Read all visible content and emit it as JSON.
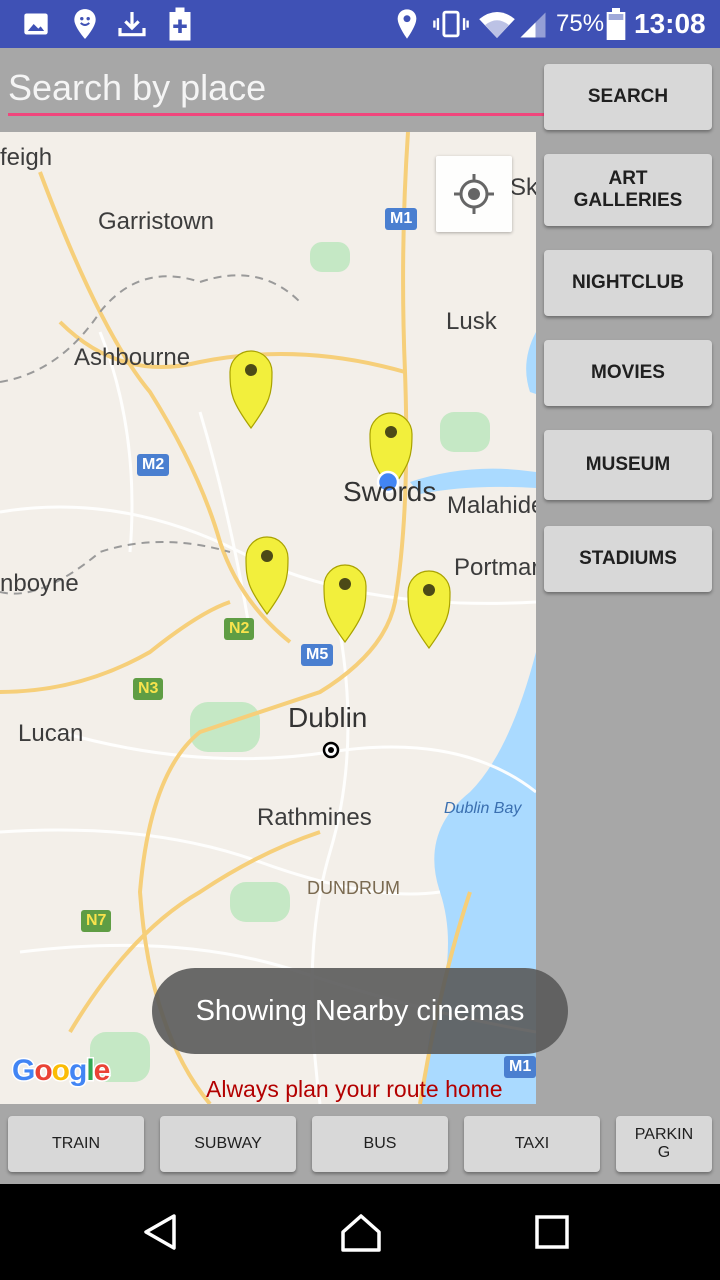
{
  "status_bar": {
    "battery_percent": "75%",
    "time": "13:08",
    "icons": [
      "image-icon",
      "location-pin-icon",
      "download-icon",
      "battery-plus-icon",
      "location-icon",
      "vibrate-icon",
      "wifi-icon",
      "signal-icon",
      "battery-icon"
    ]
  },
  "search": {
    "placeholder": "Search by place",
    "value": "",
    "button_label": "SEARCH"
  },
  "categories": {
    "art_galleries": "ART GALLERIES",
    "nightclub": "NIGHTCLUB",
    "movies": "MOVIES",
    "museum": "MUSEUM",
    "stadiums": "STADIUMS"
  },
  "map": {
    "labels": {
      "feigh": "feigh",
      "garristown": "Garristown",
      "ashbourne": "Ashbourne",
      "lusk": "Lusk",
      "swords": "Swords",
      "malahide": "Malahide",
      "portmar": "Portmar",
      "nboyne": "nboyne",
      "dublin": "Dublin",
      "lucan": "Lucan",
      "rathmines": "Rathmines",
      "dundrum": "DUNDRUM",
      "dublin_bay": "Dublin Bay",
      "sk": "Sk"
    },
    "road_shields": {
      "m1_top": "M1",
      "m2": "M2",
      "n2": "N2",
      "m50": "M5",
      "n3": "N3",
      "n7": "N7",
      "m1_bottom": "M1"
    },
    "markers_count": 5,
    "google_logo": "Google",
    "route_note": "Always plan your route home",
    "colors": {
      "marker": "#f2ef3c",
      "my_location": "#4285f4",
      "water": "#aadaff",
      "park": "#c5e8c5",
      "major_road": "#f6cf7a"
    }
  },
  "toast": "Showing Nearby cinemas",
  "transport": {
    "train": "TRAIN",
    "subway": "SUBWAY",
    "bus": "BUS",
    "taxi": "TAXI",
    "parking": "PARKIN G"
  },
  "nav_bar": {
    "icons": [
      "back-icon",
      "home-icon",
      "recents-icon"
    ]
  }
}
